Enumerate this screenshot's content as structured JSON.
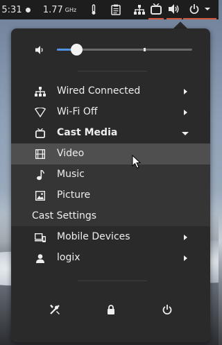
{
  "topbar": {
    "clock": "5:31",
    "cpu_freq": "1.77",
    "cpu_unit": "GHz",
    "icons": [
      "thermometer-icon",
      "clipboard-icon",
      "network-wired-icon",
      "cast-tv-icon",
      "volume-icon",
      "power-icon"
    ]
  },
  "volume": {
    "level": 0.15
  },
  "menu": {
    "items": [
      {
        "label": "Wired Connected",
        "icon": "network-wired-icon"
      },
      {
        "label": "Wi-Fi Off",
        "icon": "wifi-off-icon"
      },
      {
        "label": "Cast Media",
        "icon": "cast-tv-icon"
      },
      {
        "label": "Video",
        "icon": "film-icon"
      },
      {
        "label": "Music",
        "icon": "music-note-icon"
      },
      {
        "label": "Picture",
        "icon": "picture-icon"
      }
    ],
    "cast_settings": "Cast Settings",
    "mobile_devices": "Mobile Devices",
    "user": "logix"
  },
  "bottom_buttons": [
    "settings-tools-icon",
    "lock-icon",
    "power-icon"
  ],
  "colors": {
    "accent": "#5294e2",
    "panel": "#2a2a2a",
    "topbar": "#1d1d1d",
    "indicator": "#d0583d"
  }
}
